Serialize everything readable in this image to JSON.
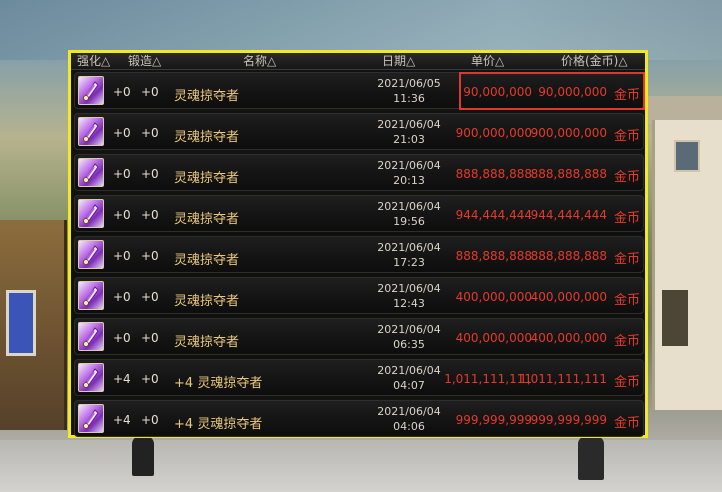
{
  "header": {
    "col_enhance": "强化△",
    "col_forge": "锻造△",
    "col_name": "名称△",
    "col_date": "日期△",
    "col_unit_price": "单价△",
    "col_price": "价格(金币)△"
  },
  "colors": {
    "panel_border": "#f2ea1d",
    "price_text": "#e53a2a",
    "name_text": "#e9c77a",
    "highlight_border": "#e0372f"
  },
  "rows": [
    {
      "icon": "soul-crystal-icon",
      "enhance": "+0",
      "forge": "+0",
      "prefix": "",
      "name": "灵魂掠夺者",
      "date": "2021/06/05",
      "time": "11:36",
      "unit_price": "90,000,000",
      "price": "90,000,000",
      "currency": "金币"
    },
    {
      "icon": "soul-crystal-icon",
      "enhance": "+0",
      "forge": "+0",
      "prefix": "",
      "name": "灵魂掠夺者",
      "date": "2021/06/04",
      "time": "21:03",
      "unit_price": "900,000,000",
      "price": "900,000,000",
      "currency": "金币"
    },
    {
      "icon": "soul-crystal-icon",
      "enhance": "+0",
      "forge": "+0",
      "prefix": "",
      "name": "灵魂掠夺者",
      "date": "2021/06/04",
      "time": "20:13",
      "unit_price": "888,888,888",
      "price": "888,888,888",
      "currency": "金币"
    },
    {
      "icon": "soul-crystal-icon",
      "enhance": "+0",
      "forge": "+0",
      "prefix": "",
      "name": "灵魂掠夺者",
      "date": "2021/06/04",
      "time": "19:56",
      "unit_price": "944,444,444",
      "price": "944,444,444",
      "currency": "金币"
    },
    {
      "icon": "soul-crystal-icon",
      "enhance": "+0",
      "forge": "+0",
      "prefix": "",
      "name": "灵魂掠夺者",
      "date": "2021/06/04",
      "time": "17:23",
      "unit_price": "888,888,888",
      "price": "888,888,888",
      "currency": "金币"
    },
    {
      "icon": "soul-crystal-icon",
      "enhance": "+0",
      "forge": "+0",
      "prefix": "",
      "name": "灵魂掠夺者",
      "date": "2021/06/04",
      "time": "12:43",
      "unit_price": "400,000,000",
      "price": "400,000,000",
      "currency": "金币"
    },
    {
      "icon": "soul-crystal-icon",
      "enhance": "+0",
      "forge": "+0",
      "prefix": "",
      "name": "灵魂掠夺者",
      "date": "2021/06/04",
      "time": "06:35",
      "unit_price": "400,000,000",
      "price": "400,000,000",
      "currency": "金币"
    },
    {
      "icon": "soul-crystal-icon",
      "enhance": "+4",
      "forge": "+0",
      "prefix": "+4",
      "name": "灵魂掠夺者",
      "date": "2021/06/04",
      "time": "04:07",
      "unit_price": "1,011,111,111",
      "price": "1,011,111,111",
      "currency": "金币"
    },
    {
      "icon": "soul-crystal-icon",
      "enhance": "+4",
      "forge": "+0",
      "prefix": "+4",
      "name": "灵魂掠夺者",
      "date": "2021/06/04",
      "time": "04:06",
      "unit_price": "999,999,999",
      "price": "999,999,999",
      "currency": "金币"
    }
  ]
}
